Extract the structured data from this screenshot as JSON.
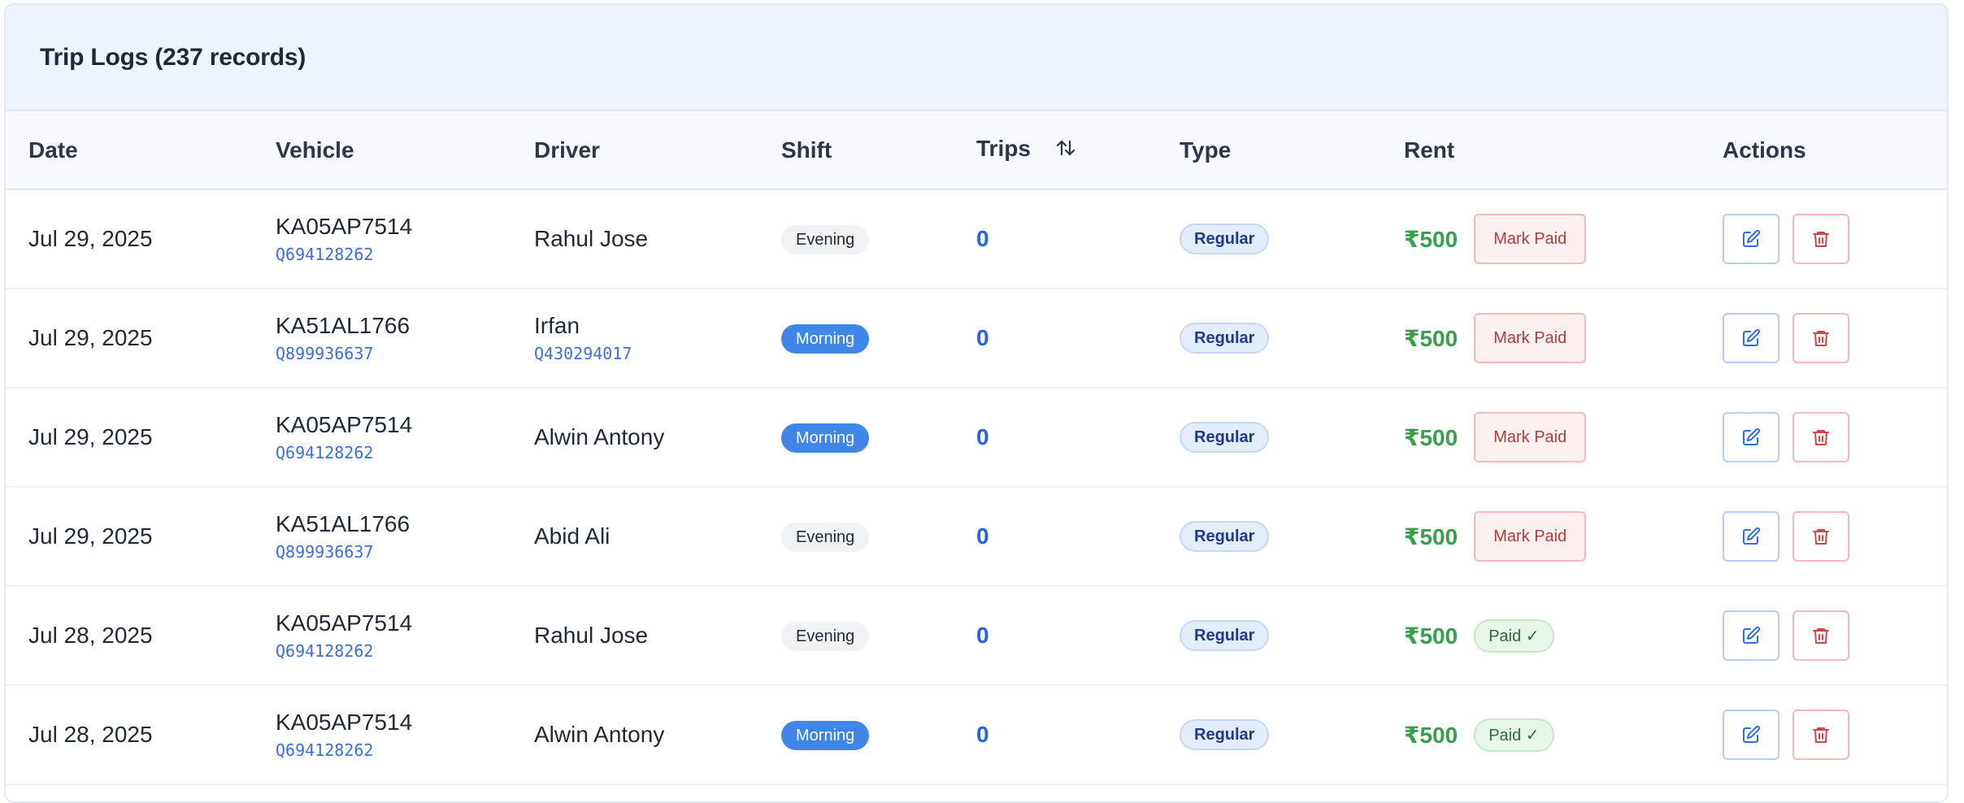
{
  "panel": {
    "title": "Trip Logs (237 records)"
  },
  "columns": {
    "date": "Date",
    "vehicle": "Vehicle",
    "driver": "Driver",
    "shift": "Shift",
    "trips": "Trips",
    "type": "Type",
    "rent": "Rent",
    "actions": "Actions"
  },
  "icons": {
    "sort": "sort-arrows-icon",
    "edit": "edit-icon",
    "delete": "trash-icon"
  },
  "colors": {
    "accent_blue": "#2563eb",
    "morning_pill": "#3f86e8",
    "rent_green": "#38a04a",
    "danger_red": "#d64545"
  },
  "rows": [
    {
      "date": "Jul 29, 2025",
      "vehicle": "KA05AP7514",
      "vehicle_id": "Q694128262",
      "driver": "Rahul Jose",
      "driver_id": "",
      "shift": "Evening",
      "trips": "0",
      "type": "Regular",
      "rent": "₹500",
      "payment": "Mark Paid"
    },
    {
      "date": "Jul 29, 2025",
      "vehicle": "KA51AL1766",
      "vehicle_id": "Q899936637",
      "driver": "Irfan",
      "driver_id": "Q430294017",
      "shift": "Morning",
      "trips": "0",
      "type": "Regular",
      "rent": "₹500",
      "payment": "Mark Paid"
    },
    {
      "date": "Jul 29, 2025",
      "vehicle": "KA05AP7514",
      "vehicle_id": "Q694128262",
      "driver": "Alwin Antony",
      "driver_id": "",
      "shift": "Morning",
      "trips": "0",
      "type": "Regular",
      "rent": "₹500",
      "payment": "Mark Paid"
    },
    {
      "date": "Jul 29, 2025",
      "vehicle": "KA51AL1766",
      "vehicle_id": "Q899936637",
      "driver": "Abid Ali",
      "driver_id": "",
      "shift": "Evening",
      "trips": "0",
      "type": "Regular",
      "rent": "₹500",
      "payment": "Mark Paid"
    },
    {
      "date": "Jul 28, 2025",
      "vehicle": "KA05AP7514",
      "vehicle_id": "Q694128262",
      "driver": "Rahul Jose",
      "driver_id": "",
      "shift": "Evening",
      "trips": "0",
      "type": "Regular",
      "rent": "₹500",
      "payment": "Paid ✓"
    },
    {
      "date": "Jul 28, 2025",
      "vehicle": "KA05AP7514",
      "vehicle_id": "Q694128262",
      "driver": "Alwin Antony",
      "driver_id": "",
      "shift": "Morning",
      "trips": "0",
      "type": "Regular",
      "rent": "₹500",
      "payment": "Paid ✓"
    }
  ]
}
